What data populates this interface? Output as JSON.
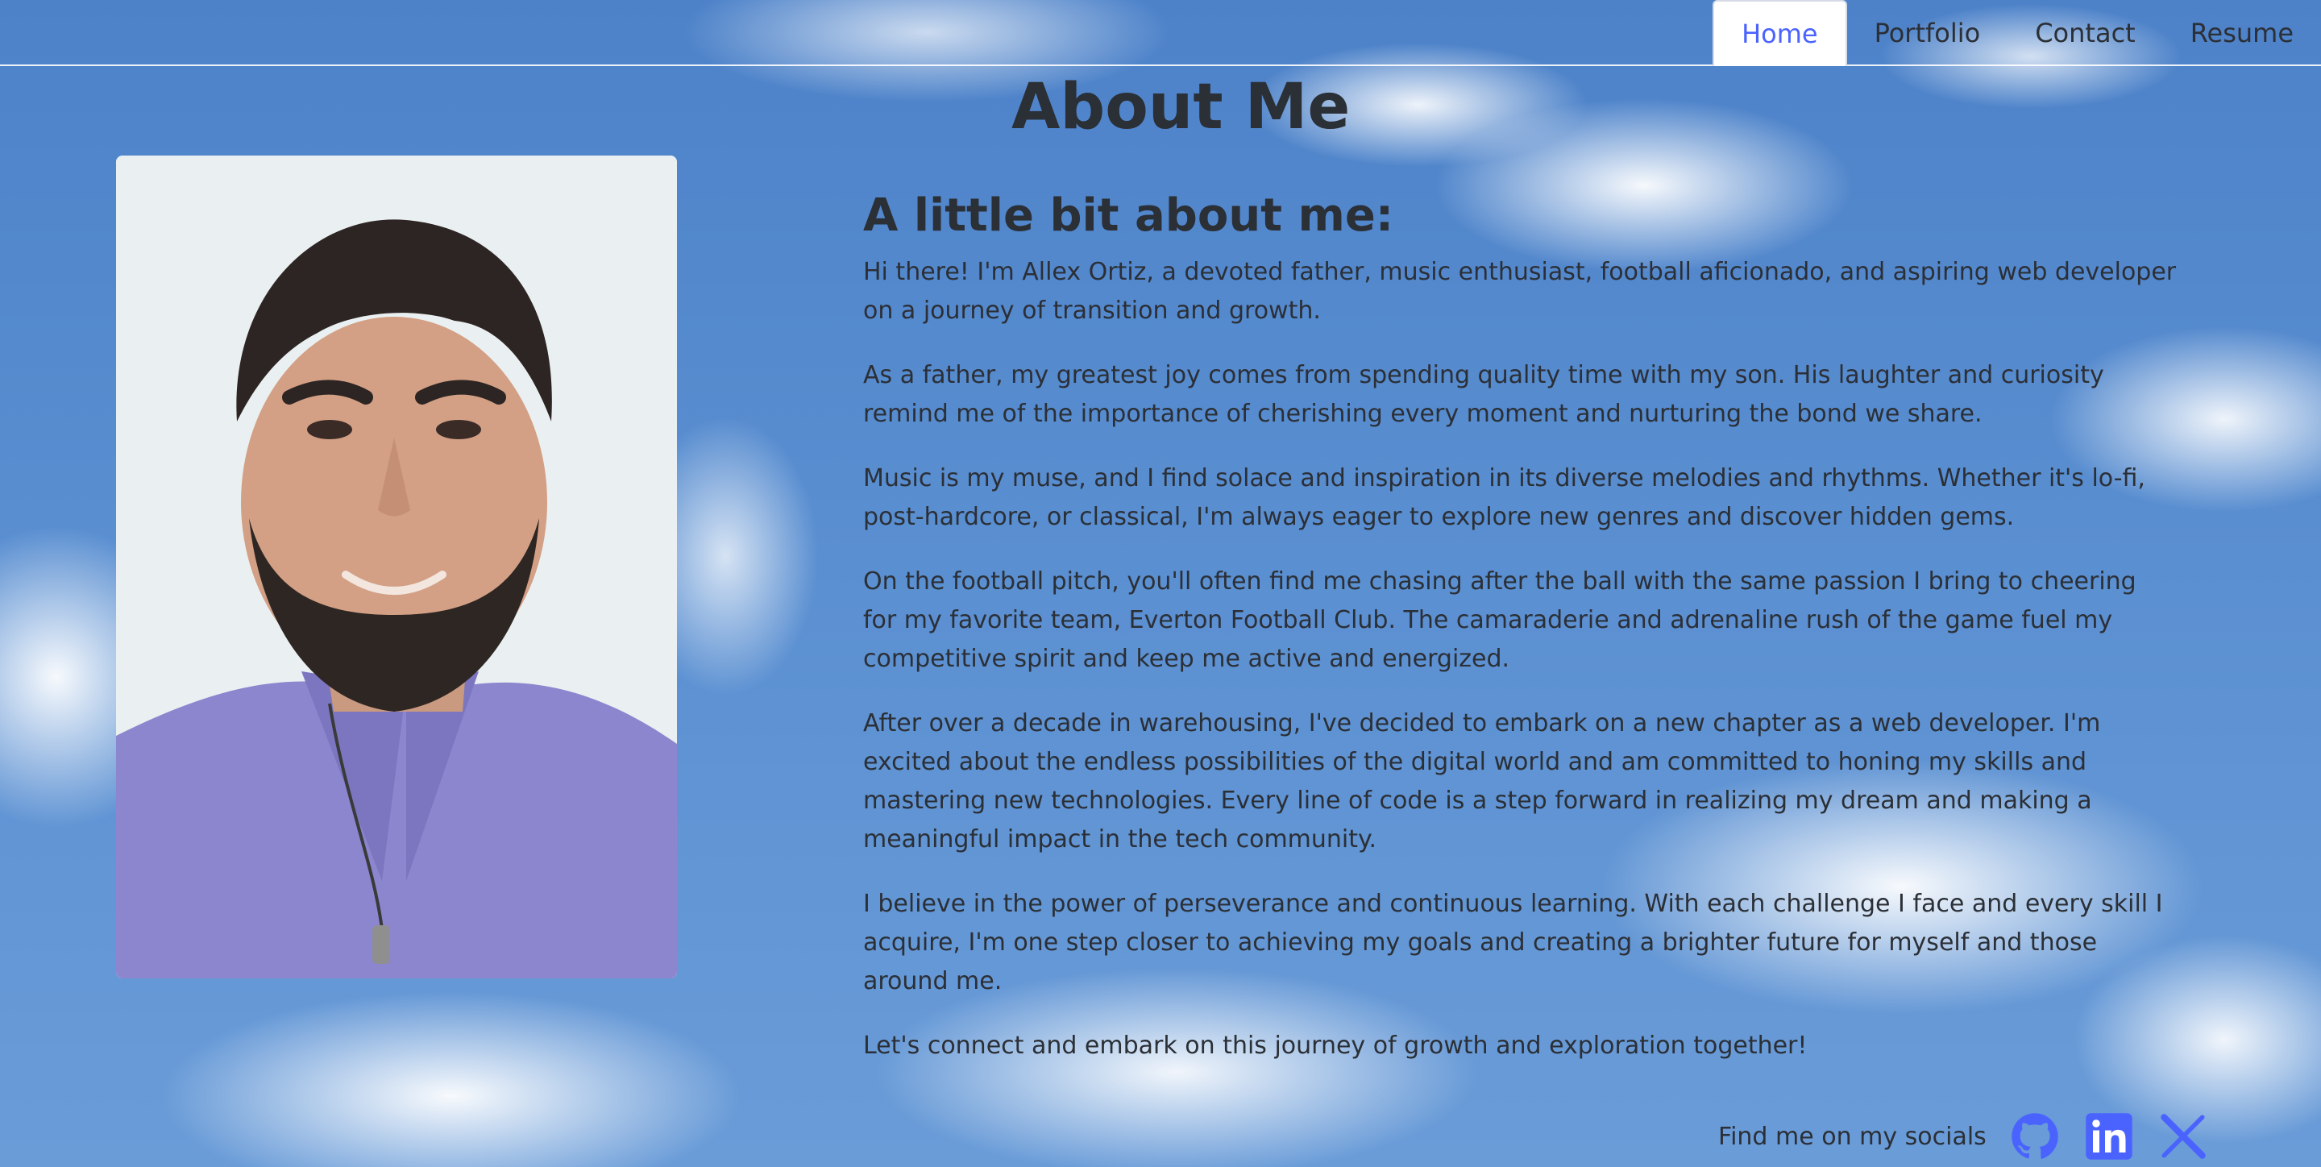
{
  "nav": {
    "items": [
      {
        "label": "Home",
        "active": true
      },
      {
        "label": "Portfolio",
        "active": false
      },
      {
        "label": "Contact",
        "active": false
      },
      {
        "label": "Resume",
        "active": false
      }
    ]
  },
  "page": {
    "title": "About Me",
    "subtitle": "A little bit about me:"
  },
  "about": {
    "paragraphs": [
      "Hi there! I'm Allex Ortiz, a devoted father, music enthusiast, football aficionado, and aspiring web developer on a journey of transition and growth.",
      "As a father, my greatest joy comes from spending quality time with my son. His laughter and curiosity remind me of the importance of cherishing every moment and nurturing the bond we share.",
      "Music is my muse, and I find solace and inspiration in its diverse melodies and rhythms. Whether it's lo-fi, post-hardcore, or classical, I'm always eager to explore new genres and discover hidden gems.",
      "On the football pitch, you'll often find me chasing after the ball with the same passion I bring to cheering for my favorite team, Everton Football Club. The camaraderie and adrenaline rush of the game fuel my competitive spirit and keep me active and energized.",
      "After over a decade in warehousing, I've decided to embark on a new chapter as a web developer. I'm excited about the endless possibilities of the digital world and am committed to honing my skills and mastering new technologies. Every line of code is a step forward in realizing my dream and making a meaningful impact in the tech community.",
      "I believe in the power of perseverance and continuous learning. With each challenge I face and every skill I acquire, I'm one step closer to achieving my goals and creating a brighter future for myself and those around me.",
      "Let's connect and embark on this journey of growth and exploration together!"
    ]
  },
  "socials": {
    "label": "Find me on my socials",
    "icons": [
      "github-icon",
      "linkedin-icon",
      "x-icon"
    ],
    "icon_color": "#4a63ff"
  },
  "colors": {
    "accent": "#4a63ff",
    "text": "#2b2f36",
    "sky": "#4d82c9"
  }
}
